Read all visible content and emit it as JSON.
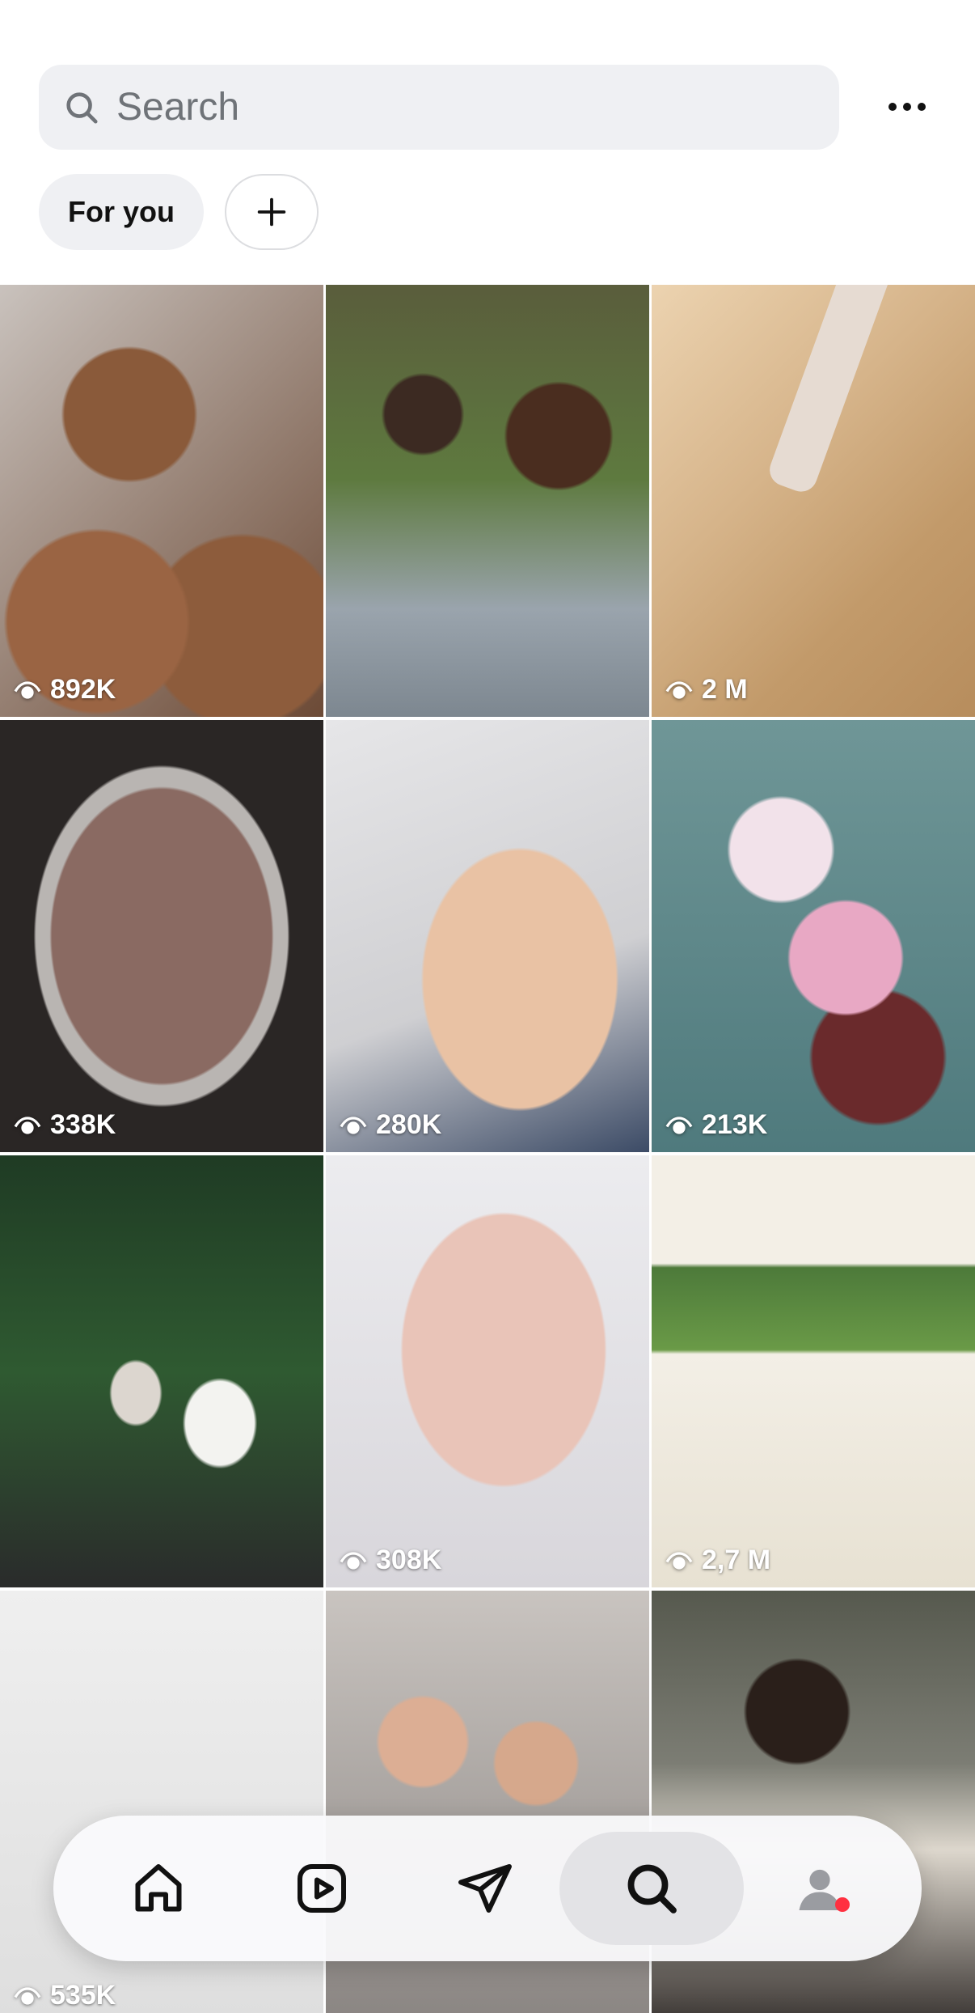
{
  "search": {
    "placeholder": "Search",
    "value": ""
  },
  "header": {
    "more_icon": "more-horizontal-icon"
  },
  "filters": [
    {
      "label": "For you",
      "selected": true
    },
    {
      "label": "+",
      "icon": "plus-icon"
    }
  ],
  "grid": {
    "tiles": [
      {
        "views": "892K"
      },
      {
        "views": ""
      },
      {
        "views": "2 M"
      },
      {
        "views": "338K"
      },
      {
        "views": "280K"
      },
      {
        "views": "213K"
      },
      {
        "views": ""
      },
      {
        "views": "308K"
      },
      {
        "views": "2,7 M"
      },
      {
        "views": "535K"
      },
      {
        "views": ""
      },
      {
        "views": ""
      }
    ]
  },
  "navbar": {
    "items": [
      {
        "icon": "home-icon",
        "active": false
      },
      {
        "icon": "reels-icon",
        "active": false
      },
      {
        "icon": "direct-message-icon",
        "active": false
      },
      {
        "icon": "search-icon",
        "active": true
      },
      {
        "icon": "profile-icon",
        "active": false,
        "notification_color": "#ff3040"
      }
    ]
  },
  "colors": {
    "search_bg": "#eff0f3",
    "chip_bg": "#eff0f3",
    "notification": "#ff3040"
  }
}
